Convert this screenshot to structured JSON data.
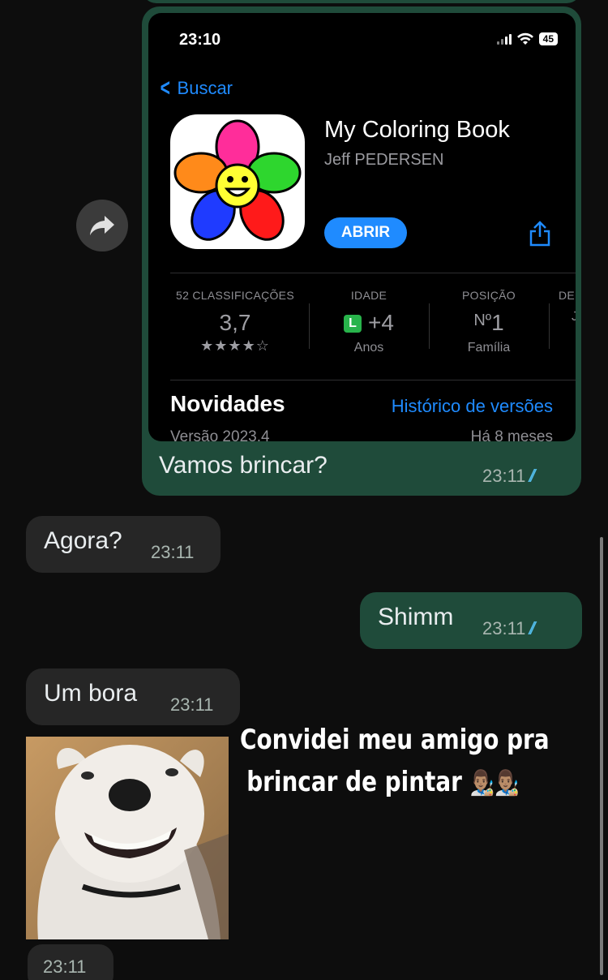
{
  "chat": {
    "messages": [
      {
        "id": "m1",
        "direction": "out",
        "text": "Vamos brincar?",
        "time": "23:11",
        "status": "read"
      },
      {
        "id": "m2",
        "direction": "in",
        "text": "Agora?",
        "time": "23:11"
      },
      {
        "id": "m3",
        "direction": "out",
        "text": "Shimm",
        "time": "23:11",
        "status": "read"
      },
      {
        "id": "m4",
        "direction": "in",
        "text": "Um bora",
        "time": "23:11"
      },
      {
        "id": "m5",
        "direction": "in",
        "type": "image",
        "time": "23:11"
      }
    ],
    "overlay_caption": {
      "line1": "Convidei meu amigo pra",
      "line2": "brincar de pintar",
      "emoji": "👨🏽‍🎨👨🏽‍🎨"
    },
    "colors": {
      "outgoing_bubble": "#1f4b3a",
      "incoming_bubble": "#262626",
      "read_ticks": "#53bdeb"
    }
  },
  "screenshot": {
    "status_time": "23:10",
    "battery": "45",
    "back_label": "Buscar",
    "app": {
      "name": "My Coloring Book",
      "developer": "Jeff PEDERSEN",
      "open_label": "ABRIR"
    },
    "info": [
      {
        "header": "52 CLASSIFICAÇÕES",
        "value": "3,7",
        "sub": "★★★★☆"
      },
      {
        "header": "IDADE",
        "badge": "L",
        "value": "+4",
        "sub": "Anos"
      },
      {
        "header": "POSIÇÃO",
        "prefix": "Nº",
        "value": "1",
        "sub": "Família"
      },
      {
        "header": "DE",
        "value": "",
        "sub": "J"
      }
    ],
    "news": {
      "title": "Novidades",
      "link": "Histórico de versões",
      "version": "Versão 2023.4",
      "when": "Há 8 meses"
    },
    "accent": "#1f8bff"
  },
  "icons": [
    "forward-icon",
    "share-icon",
    "back-chevron-icon",
    "read-ticks-icon",
    "wifi-icon",
    "signal-icon",
    "battery-icon"
  ]
}
